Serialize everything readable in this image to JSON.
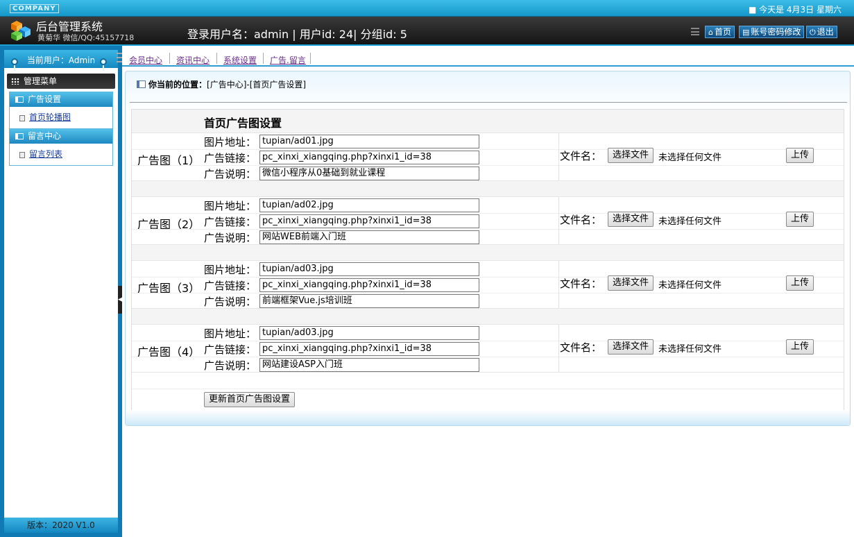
{
  "header": {
    "company": "COMPANY",
    "date_text": "■ 今天是 4月3日  星期六",
    "system_title": "后台管理系统",
    "system_sub": "黄菊华 微信/QQ:45157718",
    "login_info": "登录用户名：admin | 用户id: 24| 分组id: 5",
    "buttons": [
      {
        "label": "首页",
        "icon": "home-icon"
      },
      {
        "label": "账号密码修改",
        "icon": "account-icon"
      },
      {
        "label": "退出",
        "icon": "power-icon"
      }
    ]
  },
  "sidebar": {
    "current_user": "当前用户：Admin",
    "menu_title": "管理菜单",
    "groups": [
      {
        "title": "广告设置",
        "items": [
          "首页轮播图"
        ]
      },
      {
        "title": "留言中心",
        "items": [
          "留言列表"
        ]
      }
    ],
    "version": "版本：2020 V1.0"
  },
  "nav": {
    "items": [
      "会员中心",
      "资讯中心",
      "系统设置",
      "广告.留言"
    ]
  },
  "breadcrumb": {
    "label": "你当前的位置：",
    "path": "[广告中心]-[首页广告设置]"
  },
  "form": {
    "title": "首页广告图设置",
    "label_image": "图片地址：",
    "label_link": "广告链接：",
    "label_desc": "广告说明：",
    "filename_label": "文件名：",
    "choose_file": "选择文件",
    "no_file": "未选择任何文件",
    "upload": "上传",
    "submit": "更新首页广告图设置",
    "ads": [
      {
        "label": "广告图（1）",
        "image": "tupian/ad01.jpg",
        "link": "pc_xinxi_xiangqing.php?xinxi1_id=38",
        "desc": "微信小程序从0基础到就业课程"
      },
      {
        "label": "广告图（2）",
        "image": "tupian/ad02.jpg",
        "link": "pc_xinxi_xiangqing.php?xinxi1_id=38",
        "desc": "网站WEB前端入门班"
      },
      {
        "label": "广告图（3）",
        "image": "tupian/ad03.jpg",
        "link": "pc_xinxi_xiangqing.php?xinxi1_id=38",
        "desc": "前端框架Vue.js培训班"
      },
      {
        "label": "广告图（4）",
        "image": "tupian/ad03.jpg",
        "link": "pc_xinxi_xiangqing.php?xinxi1_id=38",
        "desc": "网站建设ASP入门班"
      }
    ]
  },
  "colors": {
    "accent": "#1d88c0",
    "header_dark": "#1a1a1a",
    "link": "#1a3e9a"
  }
}
